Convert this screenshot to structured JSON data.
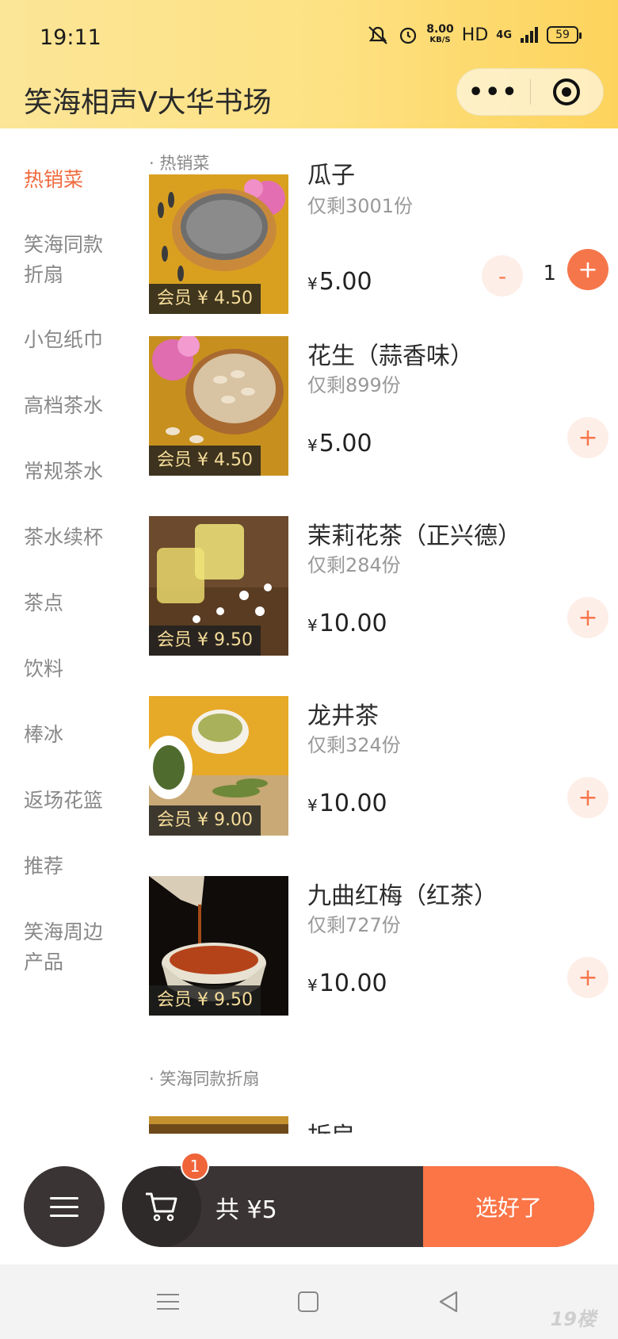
{
  "status_bar": {
    "time": "19:11",
    "network_speed": "8.00",
    "network_speed_unit": "KB/S",
    "hd": "HD",
    "signal": "4G",
    "battery": "59"
  },
  "header": {
    "title": "笑海相声V大华书场",
    "more_label": "•••"
  },
  "sidebar": {
    "items": [
      {
        "label": "热销菜"
      },
      {
        "label": "笑海同款折扇"
      },
      {
        "label": "小包纸巾"
      },
      {
        "label": "高档茶水"
      },
      {
        "label": "常规茶水"
      },
      {
        "label": "茶水续杯"
      },
      {
        "label": "茶点"
      },
      {
        "label": "饮料"
      },
      {
        "label": "棒冰"
      },
      {
        "label": "返场花篮"
      },
      {
        "label": "推荐"
      },
      {
        "label": "笑海周边产品"
      }
    ]
  },
  "sections": [
    {
      "title": "· 热销菜",
      "products": [
        {
          "name": "瓜子",
          "stock": "仅剩3001份",
          "member_price": "会员 ¥ 4.50",
          "currency": "¥",
          "price": "5.00",
          "qty": "1",
          "minus": "-",
          "plus": "+"
        },
        {
          "name": "花生（蒜香味）",
          "stock": "仅剩899份",
          "member_price": "会员 ¥ 4.50",
          "currency": "¥",
          "price": "5.00",
          "plus": "+"
        },
        {
          "name": "茉莉花茶（正兴德）",
          "stock": "仅剩284份",
          "member_price": "会员 ¥ 9.50",
          "currency": "¥",
          "price": "10.00",
          "plus": "+"
        },
        {
          "name": "龙井茶",
          "stock": "仅剩324份",
          "member_price": "会员 ¥ 9.00",
          "currency": "¥",
          "price": "10.00",
          "plus": "+"
        },
        {
          "name": "九曲红梅（红茶）",
          "stock": "仅剩727份",
          "member_price": "会员 ¥ 9.50",
          "currency": "¥",
          "price": "10.00",
          "plus": "+"
        }
      ]
    },
    {
      "title": "· 笑海同款折扇",
      "products": [
        {
          "name": "折扇"
        }
      ]
    }
  ],
  "cart": {
    "badge_count": "1",
    "total": "共 ¥5",
    "checkout_label": "选好了"
  },
  "watermark": "19楼"
}
